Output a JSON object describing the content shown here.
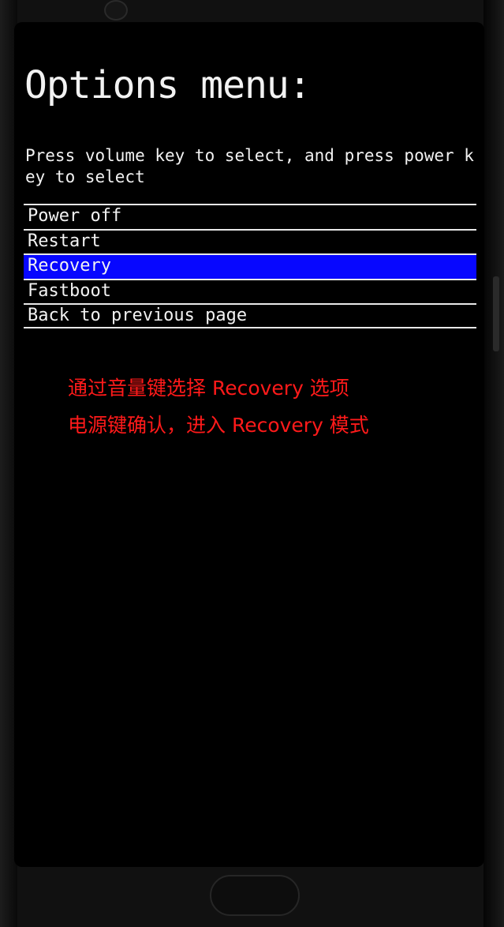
{
  "recovery_menu": {
    "title": "Options menu:",
    "instruction": "Press volume key to select, and press power key to select",
    "items": [
      {
        "label": "Power off",
        "selected": false
      },
      {
        "label": "Restart",
        "selected": false
      },
      {
        "label": "Recovery",
        "selected": true
      },
      {
        "label": "Fastboot",
        "selected": false
      },
      {
        "label": "Back to previous page",
        "selected": false
      }
    ]
  },
  "annotation": {
    "line1": "通过音量键选择 Recovery 选项",
    "line2": "电源键确认，进入 Recovery 模式"
  },
  "colors": {
    "screen_background": "#000000",
    "text": "#f2f2f2",
    "selection_highlight": "#0707ff",
    "annotation_text": "#ff1a1a"
  }
}
